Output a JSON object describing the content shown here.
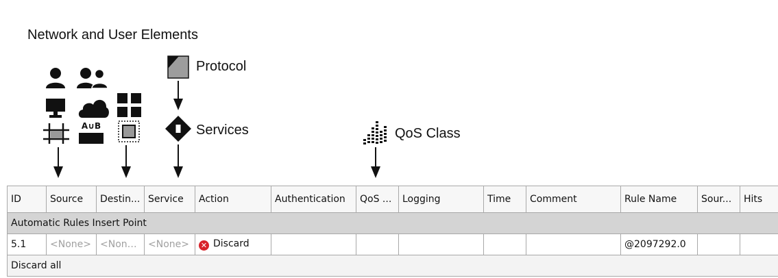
{
  "diagram": {
    "network_label": "Network and User Elements",
    "protocol_label": "Protocol",
    "services_label": "Services",
    "qos_label": "QoS Class",
    "ab_text": "A∪B"
  },
  "table": {
    "columns": [
      "ID",
      "Source",
      "Destin...",
      "Service",
      "Action",
      "Authentication",
      "QoS ...",
      "Logging",
      "Time",
      "Comment",
      "Rule Name",
      "Sour...",
      "Hits"
    ],
    "section_title": "Automatic Rules Insert Point",
    "rule": {
      "id": "5.1",
      "source": "<None>",
      "destination": "<None>",
      "service": "<None>",
      "action": "Discard",
      "rule_name": "@2097292.0"
    },
    "footer": "Discard all"
  },
  "colors": {
    "action_discard": "#d8232a",
    "section_bg": "#d4d4d4"
  },
  "icons": [
    "user-icon",
    "user-group-icon",
    "monitor-icon",
    "cloud-icon",
    "grid-icon",
    "network-icon",
    "ab-group-icon",
    "dotted-object-icon",
    "protocol-icon",
    "service-icon",
    "qos-icon",
    "arrow-down-icon",
    "discard-icon"
  ]
}
